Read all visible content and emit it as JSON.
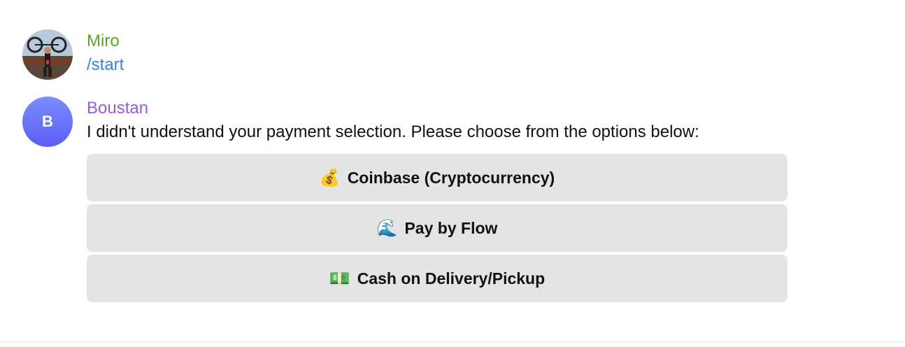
{
  "messages": [
    {
      "sender": "Miro",
      "text": "/start",
      "avatar": "user-photo"
    },
    {
      "sender": "Boustan",
      "avatar_letter": "B",
      "text": "I didn't understand your payment selection. Please choose from the options below:"
    }
  ],
  "keyboard": {
    "buttons": [
      {
        "icon": "💰",
        "icon_name": "money-bag-icon",
        "label": "Coinbase (Cryptocurrency)"
      },
      {
        "icon": "🌊",
        "icon_name": "wave-icon",
        "label": "Pay by Flow"
      },
      {
        "icon": "💵",
        "icon_name": "banknote-icon",
        "label": "Cash on Delivery/Pickup"
      }
    ]
  },
  "colors": {
    "miro_name": "#5aa52f",
    "boustan_name": "#9a5bd6",
    "command": "#3f7fd3",
    "button_bg": "#e4e4e4"
  }
}
